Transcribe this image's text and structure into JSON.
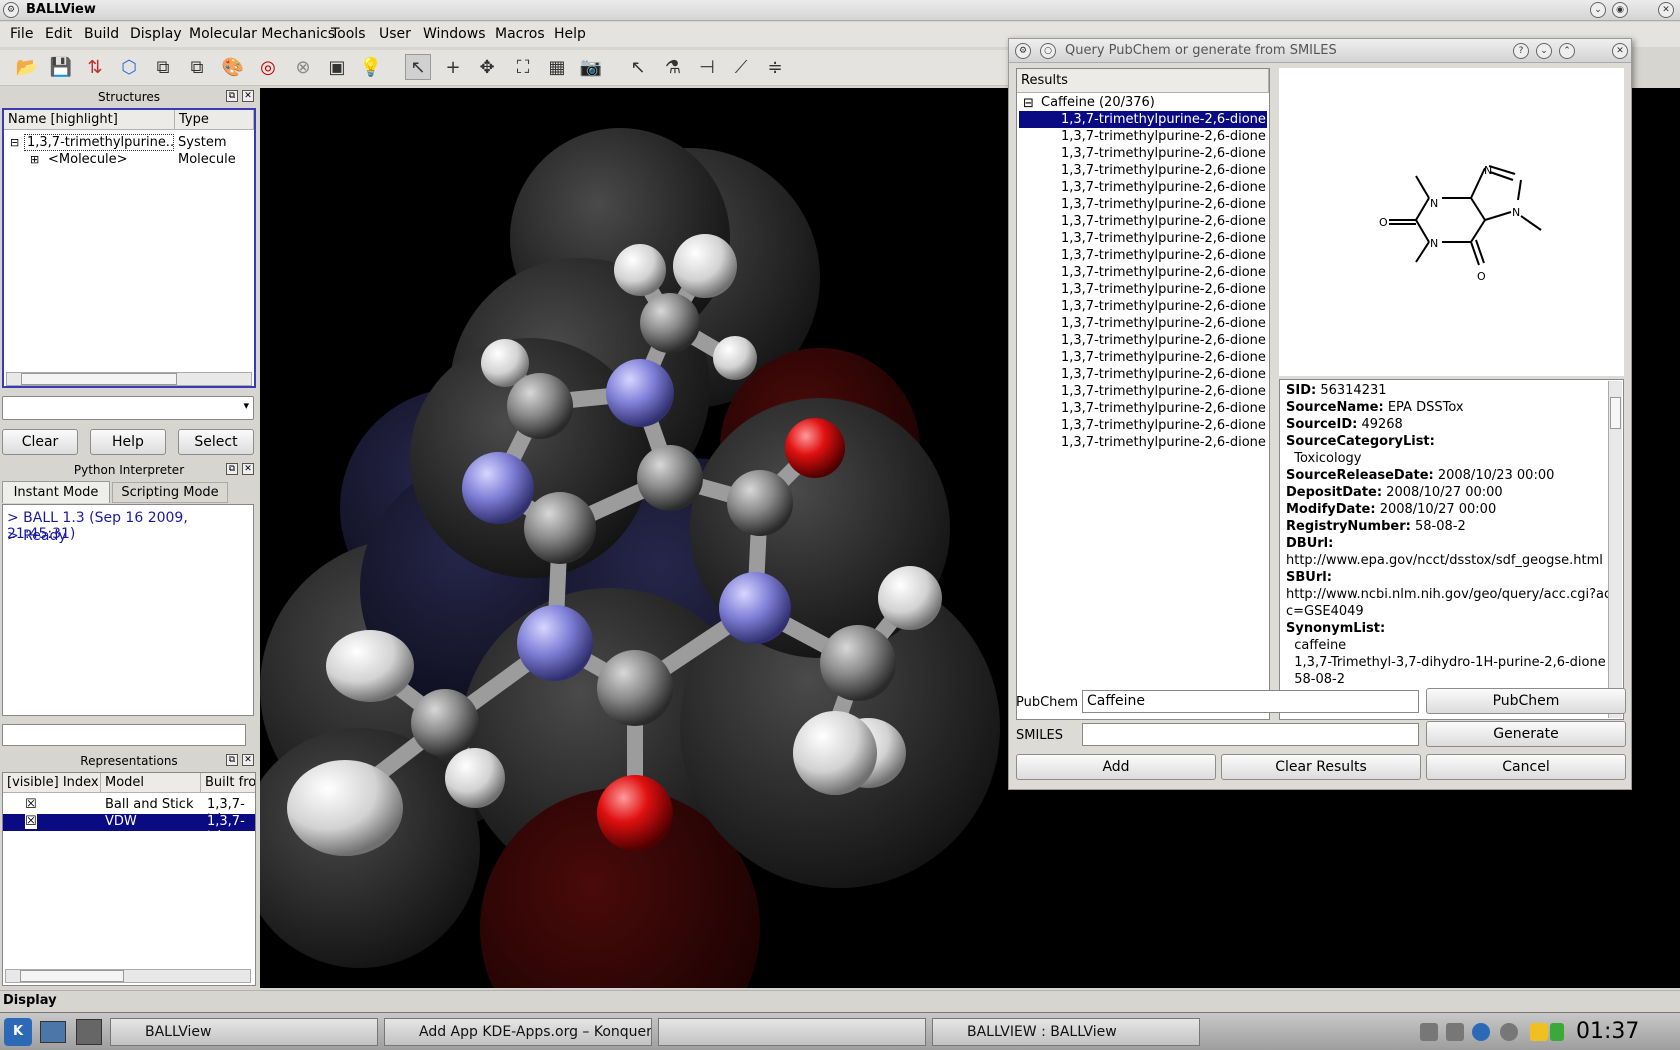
{
  "window": {
    "title": "BALLView"
  },
  "menu": [
    "File",
    "Edit",
    "Build",
    "Display",
    "Molecular Mechanics",
    "Tools",
    "User",
    "Windows",
    "Macros",
    "Help"
  ],
  "structures": {
    "title": "Structures",
    "col_name": "Name [highlight]",
    "col_type": "Type",
    "rows": [
      {
        "name": "1,3,7-trimethylpurine...",
        "type": "System"
      },
      {
        "name": "<Molecule>",
        "type": "Molecule"
      }
    ]
  },
  "buttons": {
    "clear": "Clear",
    "help": "Help",
    "select": "Select"
  },
  "python": {
    "title": "Python Interpreter",
    "tab_instant": "Instant Mode",
    "tab_scripting": "Scripting Mode",
    "lines": [
      "> BALL 1.3 (Sep 16 2009, 21:45:31)",
      "> Ready"
    ]
  },
  "representations": {
    "title": "Representations",
    "col_visible": "[visible] Index",
    "col_model": "Model",
    "col_built": "Built fro",
    "rows": [
      {
        "model": "Ball and Stick",
        "built": "1,3,7-tri",
        "visible": "☒"
      },
      {
        "model": "VDW",
        "built": "1,3,7-tri",
        "visible": "☒"
      }
    ]
  },
  "dialog": {
    "title": "Query PubChem or generate from SMILES",
    "results_header": "Results",
    "root": "Caffeine (20/376)",
    "items": [
      "1,3,7-trimethylpurine-2,6-dione",
      "1,3,7-trimethylpurine-2,6-dione",
      "1,3,7-trimethylpurine-2,6-dione",
      "1,3,7-trimethylpurine-2,6-dione",
      "1,3,7-trimethylpurine-2,6-dione",
      "1,3,7-trimethylpurine-2,6-dione",
      "1,3,7-trimethylpurine-2,6-dione",
      "1,3,7-trimethylpurine-2,6-dione",
      "1,3,7-trimethylpurine-2,6-dione",
      "1,3,7-trimethylpurine-2,6-dione",
      "1,3,7-trimethylpurine-2,6-dione",
      "1,3,7-trimethylpurine-2,6-dione",
      "1,3,7-trimethylpurine-2,6-dione",
      "1,3,7-trimethylpurine-2,6-dione",
      "1,3,7-trimethylpurine-2,6-dione",
      "1,3,7-trimethylpurine-2,6-dione",
      "1,3,7-trimethylpurine-2,6-dione",
      "1,3,7-trimethylpurine-2,6-dione",
      "1,3,7-trimethylpurine-2,6-dione",
      "1,3,7-trimethylpurine-2,6-dione"
    ],
    "info": [
      {
        "k": "SID:",
        "v": " 56314231"
      },
      {
        "k": "SourceName:",
        "v": " EPA DSSTox"
      },
      {
        "k": "SourceID:",
        "v": " 49268"
      },
      {
        "k": "SourceCategoryList:",
        "v": ""
      },
      {
        "k": "",
        "v": "  Toxicology"
      },
      {
        "k": "SourceReleaseDate:",
        "v": " 2008/10/23 00:00"
      },
      {
        "k": "DepositDate:",
        "v": " 2008/10/27 00:00"
      },
      {
        "k": "ModifyDate:",
        "v": " 2008/10/27 00:00"
      },
      {
        "k": "RegistryNumber:",
        "v": " 58-08-2"
      },
      {
        "k": "DBUrl:",
        "v": ""
      },
      {
        "k": "",
        "v": "http://www.epa.gov/ncct/dsstox/sdf_geogse.html"
      },
      {
        "k": "SBUrl:",
        "v": ""
      },
      {
        "k": "",
        "v": "http://www.ncbi.nlm.nih.gov/geo/query/acc.cgi?ac"
      },
      {
        "k": "",
        "v": "c=GSE4049"
      },
      {
        "k": "SynonymList:",
        "v": ""
      },
      {
        "k": "",
        "v": "  caffeine"
      },
      {
        "k": "",
        "v": "  1,3,7-Trimethyl-3,7-dihydro-1H-purine-2,6-dione"
      },
      {
        "k": "",
        "v": "  58-08-2"
      }
    ],
    "atoms": {
      "n": "N",
      "o": "O"
    },
    "pubchem_label": "PubChem",
    "pubchem_value": "Caffeine",
    "pubchem_button": "PubChem",
    "smiles_label": "SMILES",
    "smiles_value": "",
    "generate_button": "Generate",
    "add_button": "Add",
    "clear_results_button": "Clear Results",
    "cancel_button": "Cancel"
  },
  "status": "Display",
  "taskbar": {
    "tasks": [
      "BALLView",
      "Add App KDE-Apps.org – Konqueror",
      "",
      "BALLVIEW : BALLView"
    ],
    "clock": "01:37"
  }
}
